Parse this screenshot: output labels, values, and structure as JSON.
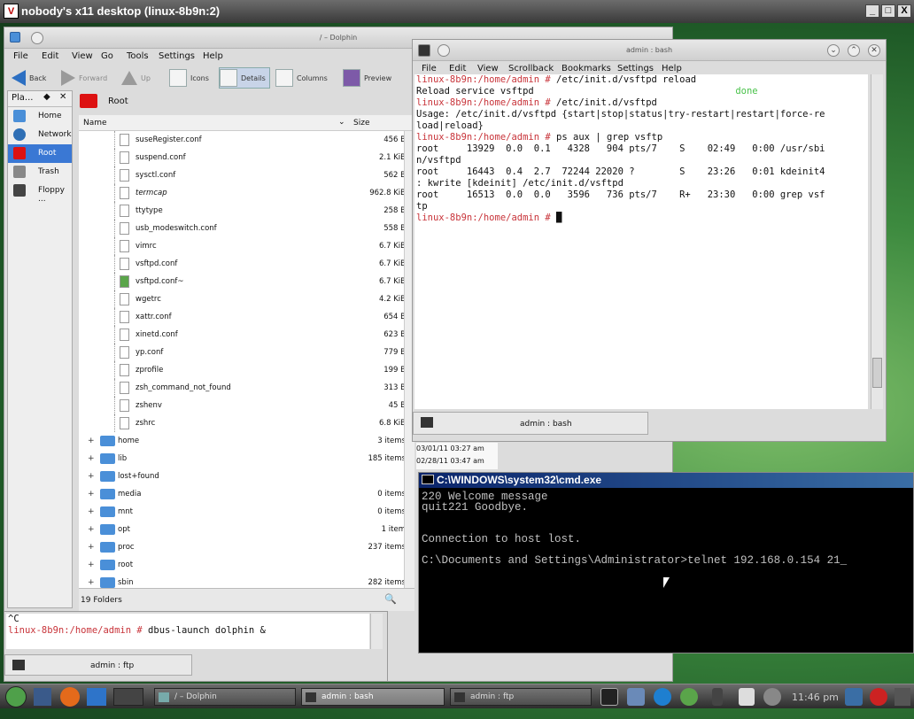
{
  "vnc": {
    "title": "nobody's x11 desktop (linux-8b9n:2)",
    "logo": "V",
    "min": "_",
    "max": "□",
    "close": "X"
  },
  "dolphin": {
    "title": "/ – Dolphin",
    "menu": [
      "File",
      "Edit",
      "View",
      "Go",
      "Tools",
      "Settings",
      "Help"
    ],
    "toolbar": {
      "back": "Back",
      "forward": "Forward",
      "up": "Up",
      "icons": "Icons",
      "details": "Details",
      "columns": "Columns",
      "preview": "Preview"
    },
    "places_title": "Pla...",
    "places": [
      {
        "label": "Home",
        "icon": "home-icon",
        "color": "#4a8fd8"
      },
      {
        "label": "Network",
        "icon": "network-icon",
        "color": "#2f6fb5"
      },
      {
        "label": "Root",
        "icon": "root-folder-icon",
        "color": "#d11"
      },
      {
        "label": "Trash",
        "icon": "trash-icon",
        "color": "#888"
      },
      {
        "label": "Floppy ...",
        "icon": "floppy-icon",
        "color": "#444"
      }
    ],
    "location": "Root",
    "col_name": "Name",
    "col_size": "Size",
    "files": [
      {
        "name": "suseRegister.conf",
        "size": "456 B"
      },
      {
        "name": "suspend.conf",
        "size": "2.1 KiB"
      },
      {
        "name": "sysctl.conf",
        "size": "562 B"
      },
      {
        "name": "termcap",
        "size": "962.8 KiB"
      },
      {
        "name": "ttytype",
        "size": "258 B"
      },
      {
        "name": "usb_modeswitch.conf",
        "size": "558 B"
      },
      {
        "name": "vimrc",
        "size": "6.7 KiB"
      },
      {
        "name": "vsftpd.conf",
        "size": "6.7 KiB"
      },
      {
        "name": "vsftpd.conf~",
        "size": "6.7 KiB"
      },
      {
        "name": "wgetrc",
        "size": "4.2 KiB"
      },
      {
        "name": "xattr.conf",
        "size": "654 B"
      },
      {
        "name": "xinetd.conf",
        "size": "623 B"
      },
      {
        "name": "yp.conf",
        "size": "779 B"
      },
      {
        "name": "zprofile",
        "size": "199 B"
      },
      {
        "name": "zsh_command_not_found",
        "size": "313 B"
      },
      {
        "name": "zshenv",
        "size": "45 B"
      },
      {
        "name": "zshrc",
        "size": "6.8 KiB"
      }
    ],
    "folders": [
      {
        "name": "home",
        "size": "3 items",
        "date": "03/01/11 03:27 am"
      },
      {
        "name": "lib",
        "size": "185 items",
        "date": "02/28/11 03:47 am"
      },
      {
        "name": "lost+found",
        "size": "",
        "date": ""
      },
      {
        "name": "media",
        "size": "0 items",
        "date": ""
      },
      {
        "name": "mnt",
        "size": "0 items",
        "date": ""
      },
      {
        "name": "opt",
        "size": "1 item",
        "date": ""
      },
      {
        "name": "proc",
        "size": "237 items",
        "date": ""
      },
      {
        "name": "root",
        "size": "",
        "date": ""
      },
      {
        "name": "sbin",
        "size": "282 items",
        "date": ""
      }
    ],
    "status": "19 Folders"
  },
  "term1": {
    "title": "admin : bash",
    "menu": [
      "File",
      "Edit",
      "View",
      "Scrollback",
      "Bookmarks",
      "Settings",
      "Help"
    ],
    "lines": [
      {
        "p": "linux-8b9n:/home/admin # ",
        "t": "/etc/init.d/vsftpd reload"
      },
      {
        "p": "",
        "t": "Reload service vsftpd                                    ",
        "g": "done"
      },
      {
        "p": "linux-8b9n:/home/admin # ",
        "t": "/etc/init.d/vsftpd"
      },
      {
        "p": "",
        "t": "Usage: /etc/init.d/vsftpd {start|stop|status|try-restart|restart|force-re"
      },
      {
        "p": "",
        "t": "load|reload}"
      },
      {
        "p": "linux-8b9n:/home/admin # ",
        "t": "ps aux | grep vsftp"
      },
      {
        "p": "",
        "t": "root     13929  0.0  0.1   4328   904 pts/7    S    02:49   0:00 /usr/sbi"
      },
      {
        "p": "",
        "t": "n/vsftpd"
      },
      {
        "p": "",
        "t": "root     16443  0.4  2.7  72244 22020 ?        S    23:26   0:01 kdeinit4"
      },
      {
        "p": "",
        "t": ": kwrite [kdeinit] /etc/init.d/vsftpd"
      },
      {
        "p": "",
        "t": "root     16513  0.0  0.0   3596   736 pts/7    R+   23:30   0:00 grep vsf"
      },
      {
        "p": "",
        "t": "tp"
      },
      {
        "p": "linux-8b9n:/home/admin # ",
        "t": "█"
      }
    ],
    "tab": "admin : bash"
  },
  "cmd": {
    "title": "C:\\WINDOWS\\system32\\cmd.exe",
    "lines": [
      "220 Welcome message",
      "quit221 Goodbye.",
      "",
      "",
      "Connection to host lost.",
      "",
      "C:\\Documents and Settings\\Administrator>telnet 192.168.0.154 21_"
    ]
  },
  "term2": {
    "lines": [
      {
        "p": "",
        "t": "^C"
      },
      {
        "p": "linux-8b9n:/home/admin # ",
        "t": "dbus-launch dolphin &"
      }
    ],
    "tab": "admin : ftp"
  },
  "panel": {
    "tasks": [
      {
        "label": "/ – Dolphin",
        "active": false
      },
      {
        "label": "admin : bash",
        "active": true
      },
      {
        "label": "admin : ftp",
        "active": false
      }
    ],
    "clock": "11:46 pm"
  }
}
